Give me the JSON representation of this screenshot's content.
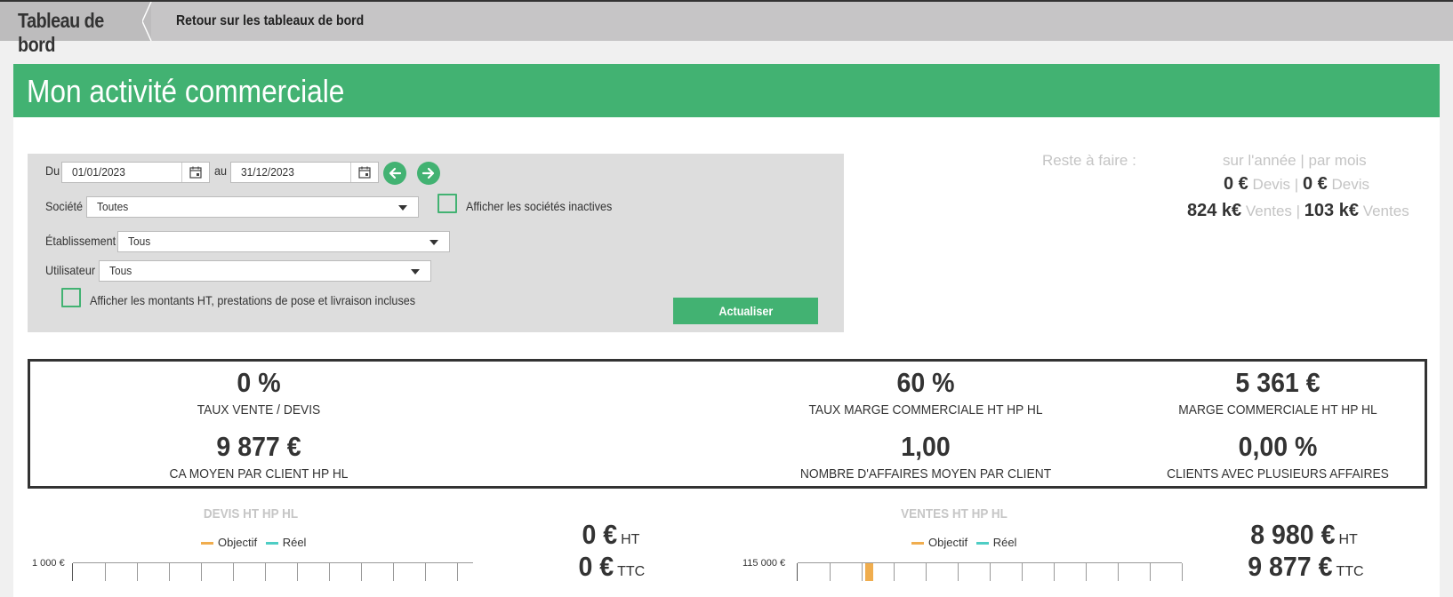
{
  "topbar": {
    "title": "Tableau de bord",
    "back_link": "Retour sur les tableaux de bord"
  },
  "page": {
    "title": "Mon activité commerciale"
  },
  "filters": {
    "from_label": "Du",
    "from_value": "01/01/2023",
    "to_label": "au",
    "to_value": "31/12/2023",
    "company_label": "Société",
    "company_value": "Toutes",
    "show_inactive_label": "Afficher les sociétés inactives",
    "establishment_label": "Établissement",
    "establishment_value": "Tous",
    "user_label": "Utilisateur",
    "user_value": "Tous",
    "show_ht_label": "Afficher les montants HT, prestations de pose et livraison incluses",
    "refresh_label": "Actualiser"
  },
  "remaining": {
    "label": "Reste à faire :",
    "period_label": "sur l'année | par mois",
    "quotes_year": "0 €",
    "quotes_month": "0 €",
    "quotes_unit": "Devis",
    "sales_year": "824 k€",
    "sales_month": "103 k€",
    "sales_unit": "Ventes",
    "sep": "|"
  },
  "kpis": {
    "sale_rate_value": "0 %",
    "sale_rate_label": "TAUX VENTE / DEVIS",
    "margin_rate_value": "60 %",
    "margin_rate_label": "TAUX MARGE COMMERCIALE HT HP HL",
    "margin_value": "5 361 €",
    "margin_label": "MARGE COMMERCIALE HT HP HL",
    "avg_revenue_value": "9 877 €",
    "avg_revenue_label": "CA MOYEN PAR CLIENT HP HL",
    "avg_deals_value": "1,00",
    "avg_deals_label": "NOMBRE D'AFFAIRES MOYEN PAR CLIENT",
    "multi_clients_value": "0,00 %",
    "multi_clients_label": "CLIENTS AVEC PLUSIEURS AFFAIRES"
  },
  "charts": {
    "quotes": {
      "title": "DEVIS HT HP HL",
      "legend_objective": "Objectif",
      "legend_real": "Réel",
      "y_top_label": "1 000 €",
      "total_ht": "0 €",
      "unit_ht": "HT",
      "total_ttc": "0 €",
      "unit_ttc": "TTC"
    },
    "sales": {
      "title": "VENTES HT HP HL",
      "legend_objective": "Objectif",
      "legend_real": "Réel",
      "y_top_label": "115 000 €",
      "total_ht": "8 980 €",
      "unit_ht": "HT",
      "total_ttc": "9 877 €",
      "unit_ttc": "TTC"
    }
  },
  "colors": {
    "accent": "#42b272",
    "objective": "#f0ad4e",
    "real": "#4ecdc4"
  }
}
